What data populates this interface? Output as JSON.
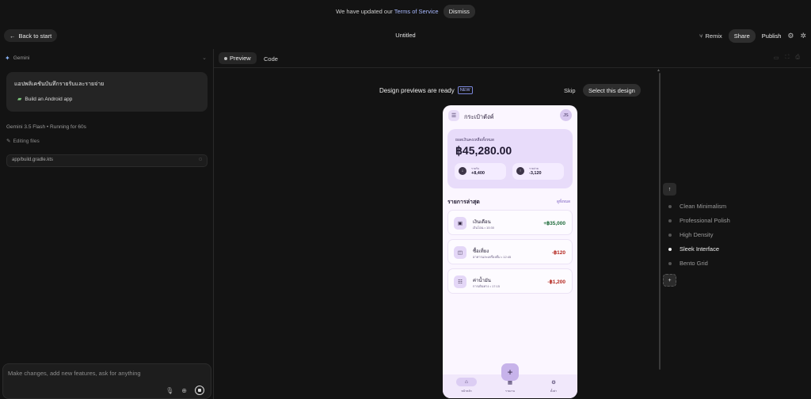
{
  "banner": {
    "message": "We have updated our",
    "link": "Terms of Service",
    "dismiss": "Dismiss"
  },
  "header": {
    "back": "Back to start",
    "title": "Untitled",
    "remix": "Remix",
    "share": "Share",
    "publish": "Publish"
  },
  "left": {
    "model_chip": "Gemini",
    "prompt_title": "แอปพลิเคชันบันทึกรายรับและรายจ่าย",
    "prompt_sub": "Build an Android app",
    "status": "Gemini 3.5 Flash  •  Running for 60s",
    "editing": "Editing files",
    "file": "app/build.gradle.kts",
    "composer_placeholder": "Make changes, add new features, ask for anything"
  },
  "tabs": {
    "preview": "Preview",
    "code": "Code"
  },
  "preview": {
    "ready": "Design previews are ready",
    "new_badge": "NEW",
    "skip": "Skip",
    "select": "Select this design"
  },
  "app": {
    "title": "กระเป๋าตังค์",
    "avatar": "JS",
    "balance_label": "ยอดเงินคงเหลือทั้งหมด",
    "balance": "฿45,280.00",
    "income_label": "รายรับ",
    "income": "+8,400",
    "expense_label": "รายจ่าย",
    "expense": "-3,120",
    "recent_title": "รายการล่าสุด",
    "see_all": "ดูทั้งหมด",
    "transactions": [
      {
        "name": "เงินเดือน",
        "sub": "เงินโอน • 10:30",
        "amount": "+฿35,000"
      },
      {
        "name": "ซื้อเที่ยง",
        "sub": "อาหารและเครื่องดื่ม • 12:45",
        "amount": "-฿120"
      },
      {
        "name": "ค่าน้ำมัน",
        "sub": "การเดินทาง • 17:15",
        "amount": "-฿1,200"
      }
    ],
    "nav": [
      "หน้าหลัก",
      "รายงาน",
      "ตั้งค่า"
    ]
  },
  "designs": [
    "Clean Minimalism",
    "Professional Polish",
    "High Density",
    "Sleek Interface",
    "Bento Grid"
  ],
  "selected_design": "Sleek Interface"
}
